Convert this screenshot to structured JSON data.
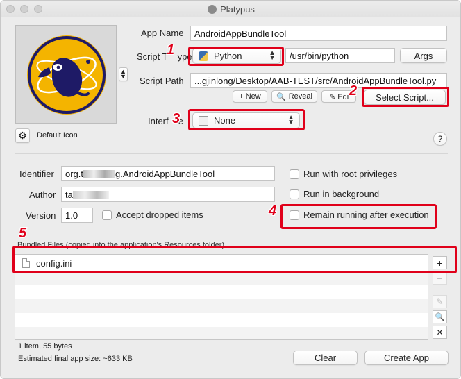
{
  "window": {
    "title": "Platypus"
  },
  "icon": {
    "default_label": "Default Icon"
  },
  "app": {
    "app_name_label": "App Name",
    "app_name_value": "AndroidAppBundleTool",
    "script_type_label_a": "Script T",
    "script_type_label_b": "ype",
    "script_type_value": "Python",
    "interpreter_path": "/usr/bin/python",
    "args_button": "Args",
    "script_path_label": "Script Path",
    "script_path_value": "...gjinlong/Desktop/AAB-TEST/src/AndroidAppBundleTool.py",
    "new_button": "+ New",
    "reveal_button": "Reveal",
    "edit_button": "✎ Edi",
    "select_script_button": "Select Script...",
    "interface_label_a": "Interf",
    "interface_label_b": "e",
    "interface_value": "None",
    "help_button": "?"
  },
  "metadata": {
    "identifier_label": "Identifier",
    "identifier_value_a": "org.t",
    "identifier_value_b": "g.AndroidAppBundleTool",
    "author_label": "Author",
    "author_value": "ta",
    "version_label": "Version",
    "version_value": "1.0",
    "accept_dropped_label": "Accept dropped items",
    "root_privileges_label": "Run with root privileges",
    "background_label": "Run in background",
    "remain_running_label": "Remain running after execution"
  },
  "bundled": {
    "header": "Bundled Files (copied into the application's Resources folder)",
    "files": [
      {
        "name": "config.ini"
      }
    ],
    "count_text": "1 item, 55 bytes",
    "size_text": "Estimated final app size: ~633 KB",
    "add_button": "+",
    "remove_button": "−",
    "edit_icon": "✎",
    "reveal_icon": "🔍",
    "clear_icon": "✕"
  },
  "footer": {
    "clear_button": "Clear",
    "create_button": "Create App"
  },
  "annotations": [
    "1",
    "2",
    "3",
    "4",
    "5"
  ],
  "colors": {
    "annotation_red": "#e0001a",
    "logo_yellow": "#f4b400",
    "logo_navy": "#1e1a66"
  }
}
